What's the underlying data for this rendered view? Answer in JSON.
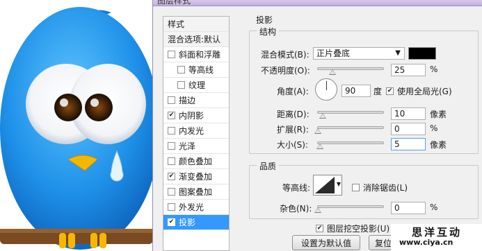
{
  "dialog": {
    "title": "图层样式",
    "style_list": {
      "header": "样式",
      "blend_options": "混合选项:默认",
      "items": [
        {
          "label": "斜面和浮雕",
          "checked": false,
          "indent": false
        },
        {
          "label": "等高线",
          "checked": false,
          "indent": true
        },
        {
          "label": "纹理",
          "checked": false,
          "indent": true
        },
        {
          "label": "描边",
          "checked": false,
          "indent": false
        },
        {
          "label": "内阴影",
          "checked": true,
          "indent": false
        },
        {
          "label": "内发光",
          "checked": false,
          "indent": false
        },
        {
          "label": "光泽",
          "checked": false,
          "indent": false
        },
        {
          "label": "颜色叠加",
          "checked": false,
          "indent": false
        },
        {
          "label": "渐变叠加",
          "checked": true,
          "indent": false
        },
        {
          "label": "图案叠加",
          "checked": false,
          "indent": false
        },
        {
          "label": "外发光",
          "checked": false,
          "indent": false
        },
        {
          "label": "投影",
          "checked": true,
          "indent": false,
          "selected": true
        }
      ]
    },
    "panel_title": "投影",
    "structure": {
      "title": "结构",
      "blend_mode_label": "混合模式(B):",
      "blend_mode_value": "正片叠底",
      "blend_color": "#000000",
      "opacity_label": "不透明度(O):",
      "opacity_value": "25",
      "opacity_unit": "%",
      "angle_label": "角度(A):",
      "angle_value": "90",
      "angle_unit": "度",
      "global_light_label": "使用全局光(G)",
      "global_light_checked": true,
      "distance_label": "距离(D):",
      "distance_value": "10",
      "distance_unit": "像素",
      "spread_label": "扩展(R):",
      "spread_value": "0",
      "spread_unit": "%",
      "size_label": "大小(S):",
      "size_value": "5",
      "size_unit": "像素"
    },
    "quality": {
      "title": "品质",
      "contour_label": "等高线:",
      "antialias_label": "消除锯齿(L)",
      "antialias_checked": false,
      "noise_label": "杂色(N):",
      "noise_value": "0",
      "noise_unit": "%"
    },
    "knockout_label": "图层挖空投影(U)",
    "knockout_checked": true,
    "default_button": "设置为默认值",
    "reset_button": "复位"
  },
  "watermark": {
    "name": "思洋互动",
    "url": "www.ciya.cn"
  },
  "colors": {
    "bird_blue": "#1e90e8",
    "beak_yellow": "#f5b800",
    "selection": "#3399ff"
  }
}
